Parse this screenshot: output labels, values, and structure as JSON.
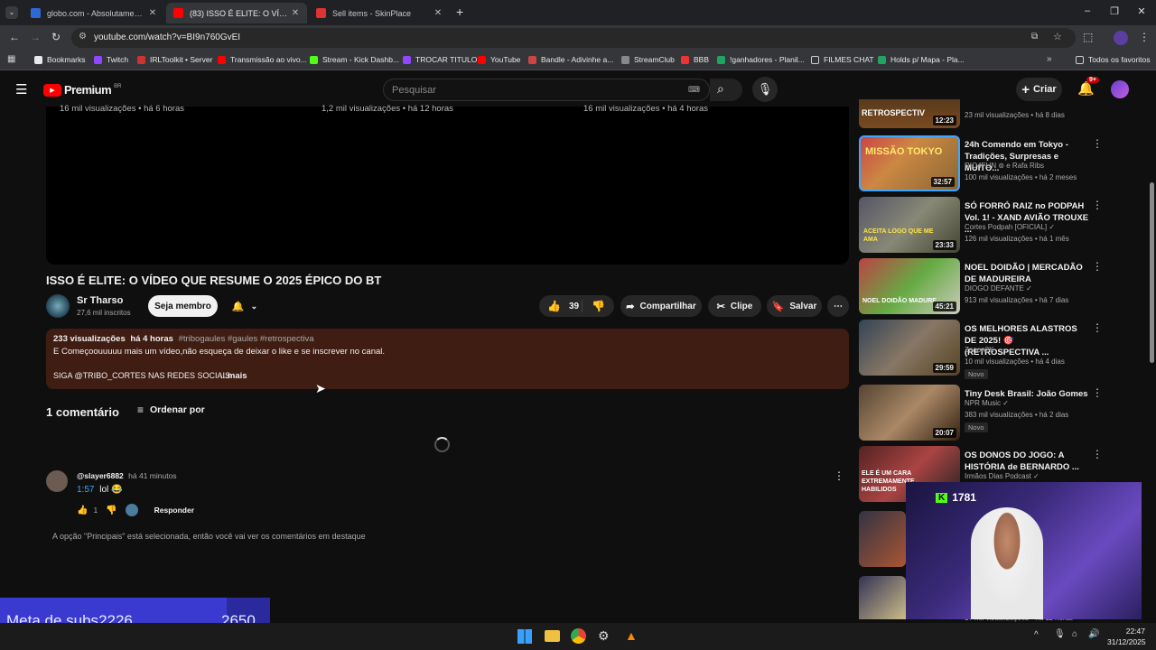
{
  "browser": {
    "tabs": [
      {
        "title": "globo.com - Absolutamente tudo"
      },
      {
        "title": "(83) ISSO É ELITE: O VÍDEO QUE RESUME"
      },
      {
        "title": "Sell items - SkinPlace"
      }
    ],
    "url": "youtube.com/watch?v=BI9n760GvEI",
    "bookmarks": [
      "Bookmarks",
      "Twitch",
      "IRLToolkit • Server",
      "Transmissão ao vivo...",
      "Stream - Kick Dashb...",
      "TROCAR TITULO",
      "YouTube",
      "Bandle - Adivinhe a...",
      "StreamClub",
      "BBB",
      "!ganhadores - Planil...",
      "FILMES CHAT",
      "Holds p/ Mapa - Pla..."
    ],
    "all_favorites": "Todos os favoritos"
  },
  "yt": {
    "logo": "Premium",
    "region": "BR",
    "search_placeholder": "Pesquisar",
    "create": "Criar",
    "notif_badge": "9+"
  },
  "prev_row": [
    "16 mil visualizações • há 6 horas",
    "1,2 mil visualizações • há 12 horas",
    "16 mil visualizações • há 4 horas"
  ],
  "video": {
    "title": "ISSO É ELITE: O VÍDEO QUE RESUME O 2025 ÉPICO DO BT",
    "channel": "Sr Tharso",
    "subs": "27,6 mil inscritos",
    "join": "Seja membro",
    "likes": "39",
    "share": "Compartilhar",
    "clip": "Clipe",
    "save": "Salvar"
  },
  "description": {
    "views": "233 visualizações",
    "age": "há 4 horas",
    "tags": "#tribogaules #gaules #retrospectiva",
    "line1": "E Começoouuuuu mais um vídeo,não esqueça de deixar o like e se inscrever no canal.",
    "line2": "SIGA @TRIBO_CORTES NAS REDES SOCIAIS",
    "more": "...mais"
  },
  "comments": {
    "count": "1 comentário",
    "sort": "Ordenar por",
    "author": "@slayer6882",
    "time": "há 41 minutos",
    "timestamp": "1:57",
    "text": "lol 😂",
    "likes": "1",
    "reply": "Responder",
    "footer": "A opção \"Principais\" está selecionada, então você vai ver os comentários em destaque"
  },
  "sidebar": [
    {
      "dur": "12:23",
      "thumb_text": "RETROSPECTIV",
      "title": "",
      "meta": "23 mil visualizações • há 8 dias"
    },
    {
      "dur": "32:57",
      "thumb_text": "MISSÃO TOKYO",
      "title": "24h Comendo em Tokyo - Tradições, Surpresas e MUITO...",
      "channel": "RIO4FUN ⊚ e Rafa Ribs",
      "meta": "100 mil visualizações • há 2 meses"
    },
    {
      "dur": "23:33",
      "thumb_text": "ACEITA LOGO QUE ME AMA",
      "title": "SÓ FORRÓ RAIZ no PODPAH Vol. 1! - XAND AVIÃO TROUXE ...",
      "channel": "Cortes Podpah [OFICIAL] ✓",
      "meta": "126 mil visualizações • há 1 mês"
    },
    {
      "dur": "45:21",
      "thumb_text": "NOEL DOIDÃO MADURE",
      "title": "NOEL DOIDÃO | MERCADÃO DE MADUREIRA",
      "channel": "DIOGO DEFANTE ✓",
      "meta": "913 mil visualizações • há 7 dias"
    },
    {
      "dur": "29:59",
      "thumb_text": "",
      "title": "OS MELHORES ALASTROS DE 2025! 🎯 (RETROSPECTIVA ...",
      "channel": "Zanon2K",
      "meta": "10 mil visualizações • há 4 dias",
      "badge": "Novo"
    },
    {
      "dur": "20:07",
      "thumb_text": "",
      "title": "Tiny Desk Brasil: João Gomes",
      "channel": "NPR Music ✓",
      "meta": "383 mil visualizações • há 2 dias",
      "badge": "Novo"
    },
    {
      "dur": "",
      "thumb_text": "ELE É UM CARA EXTREMAMENTE HABILIDOS",
      "title": "OS DONOS DO JOGO: A HISTÓRIA de BERNARDO ...",
      "channel": "Irmãos Dias Podcast ✓",
      "meta": ""
    }
  ],
  "sidebar_bottom_meta": "17 mil visualizações • há 11 horas",
  "overlay": {
    "goal_label": "Meta de subs",
    "goal_current": "2226",
    "goal_target": "2650",
    "goal_progress": 0.84,
    "kick_count": "1781"
  },
  "taskbar": {
    "time": "22:47",
    "date": "31/12/2025"
  },
  "colors": {
    "accent": "#ff0000",
    "desc_bg": "#3f1d12",
    "link": "#3ea6ff",
    "goal_bar": "#3a3ad0"
  }
}
